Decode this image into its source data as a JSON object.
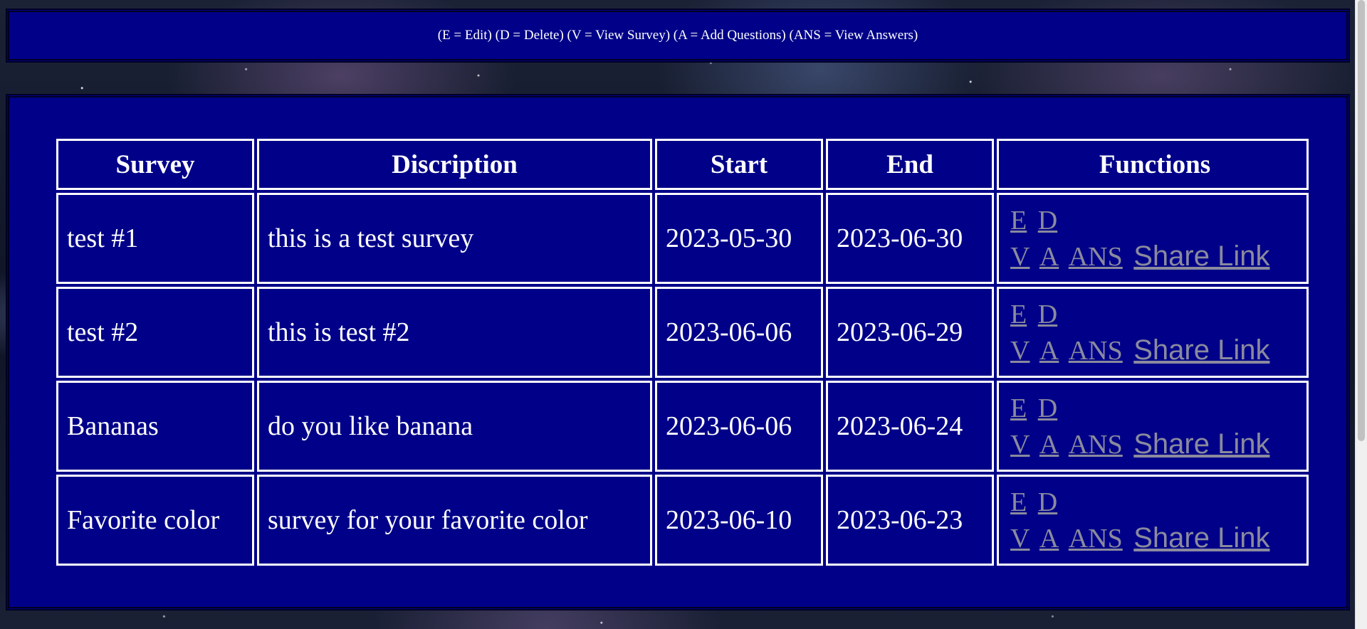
{
  "legend": {
    "text": "(E = Edit) (D = Delete) (V = View Survey) (A = Add Questions) (ANS = View Answers)"
  },
  "table": {
    "headers": {
      "survey": "Survey",
      "description": "Discription",
      "start": "Start",
      "end": "End",
      "functions": "Functions"
    },
    "rows": [
      {
        "survey": "test #1",
        "description": "this is a test survey",
        "start": "2023-05-30",
        "end": "2023-06-30"
      },
      {
        "survey": "test #2",
        "description": "this is test #2",
        "start": "2023-06-06",
        "end": "2023-06-29"
      },
      {
        "survey": "Bananas",
        "description": "do you like banana",
        "start": "2023-06-06",
        "end": "2023-06-24"
      },
      {
        "survey": "Favorite color",
        "description": "survey for your favorite color",
        "start": "2023-06-10",
        "end": "2023-06-23"
      }
    ]
  },
  "functions": {
    "edit": "E",
    "delete": "D",
    "view": "V",
    "add": "A",
    "answers": "ANS",
    "share": "Share Link"
  },
  "colors": {
    "panel_background": "#000088",
    "link": "#8a8a9e",
    "text": "#ffffff"
  }
}
